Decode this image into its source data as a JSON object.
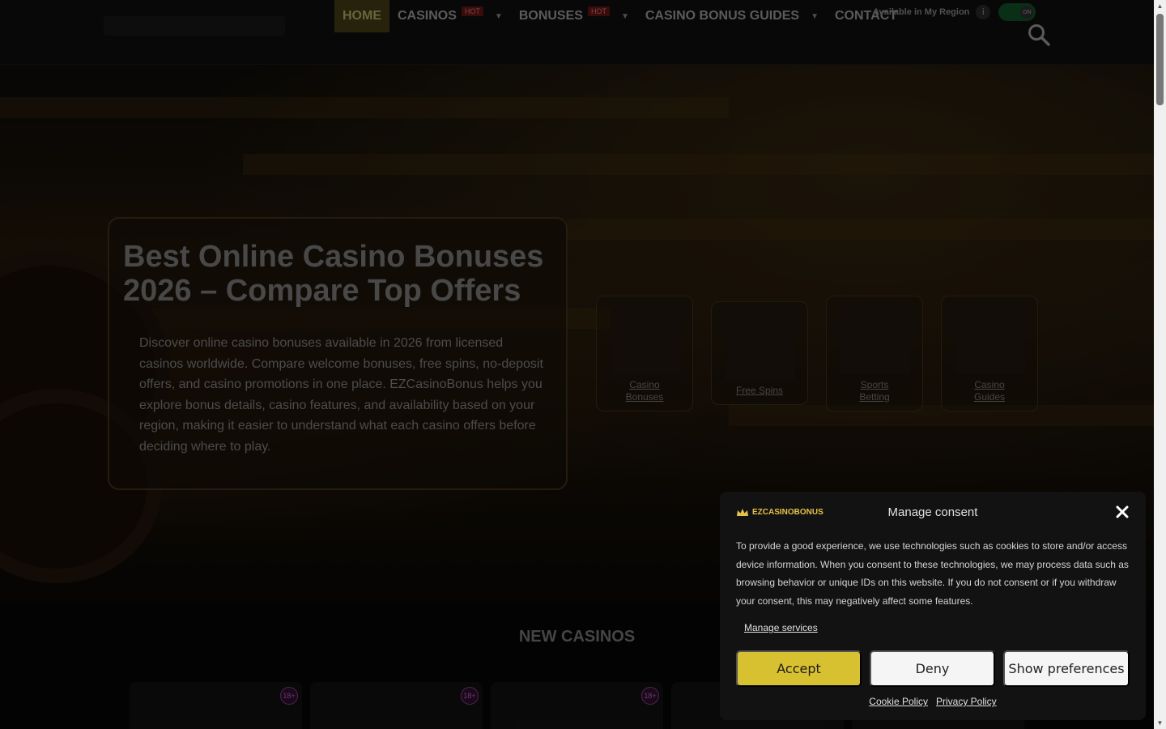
{
  "header": {
    "nav": [
      {
        "label": "HOME",
        "active": true
      },
      {
        "label": "CASINOS",
        "badge": "HOT",
        "dropdown": true
      },
      {
        "label": "BONUSES",
        "badge": "HOT",
        "dropdown": true
      },
      {
        "label": "CASINO BONUS GUIDES",
        "dropdown": true
      },
      {
        "label": "CONTACT"
      }
    ],
    "region_label": "Available in My Region",
    "info_glyph": "i",
    "toggle_text": "ON",
    "search_icon": "search-icon"
  },
  "hero": {
    "title": "Best Online Casino Bonuses 2026 – Compare Top Offers",
    "text": "Discover online casino bonuses available in 2026 from licensed casinos worldwide. Compare welcome bonuses, free spins, no-deposit offers, and casino promotions in one place. EZCasinoBonus helps you explore bonus details, casino features, and availability based on your region, making it easier to understand what each casino offers before deciding where to play.",
    "categories": [
      {
        "line1": "Casino",
        "line2": "Bonuses"
      },
      {
        "line1": "Free Spins",
        "line2": ""
      },
      {
        "line1": "Sports",
        "line2": "Betting"
      },
      {
        "line1": "Casino",
        "line2": "Guides"
      }
    ]
  },
  "new_casinos": {
    "title": "NEW CASINOS",
    "age_badge": "18+"
  },
  "consent": {
    "logo_text": "EZCASINOBONUS",
    "title": "Manage consent",
    "body": "To provide a good experience, we use technologies such as cookies to store and/or access device information. When you consent to these technologies, we may process data such as browsing behavior or unique IDs on this website. If you do not consent or if you withdraw your consent, this may negatively affect some features.",
    "manage_services": "Manage services",
    "accept": "Accept",
    "deny": "Deny",
    "preferences": "Show preferences",
    "cookie_policy": "Cookie Policy",
    "privacy_policy": "Privacy Policy"
  },
  "colors": {
    "accent": "#d8c131",
    "hot_badge": "#5a1212",
    "toggle_on": "#0e4a22"
  }
}
